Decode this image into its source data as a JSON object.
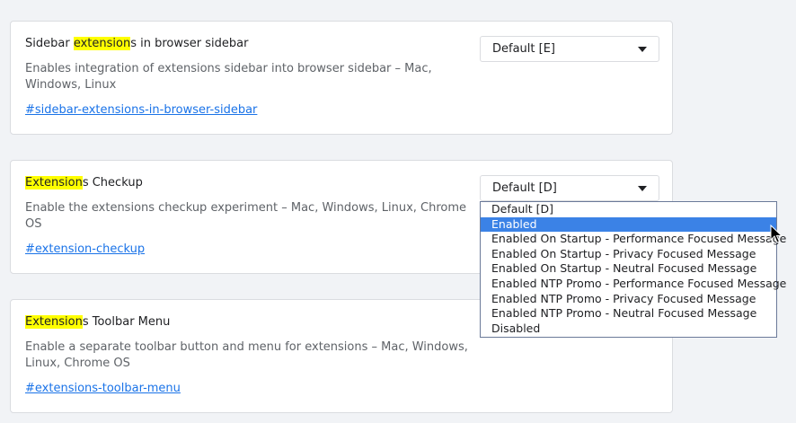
{
  "flags": [
    {
      "title_before": "Sidebar ",
      "title_highlight": "extension",
      "title_after": "s in browser sidebar",
      "description": "Enables integration of extensions sidebar into browser sidebar – Mac, Windows, Linux",
      "link": "#sidebar-extensions-in-browser-sidebar",
      "select_value": "Default [E]"
    },
    {
      "title_before": "",
      "title_highlight": "Extension",
      "title_after": "s Checkup",
      "description": "Enable the extensions checkup experiment – Mac, Windows, Linux, Chrome OS",
      "link": "#extension-checkup",
      "select_value": "Default [D]"
    },
    {
      "title_before": "",
      "title_highlight": "Extension",
      "title_after": "s Toolbar Menu",
      "description": "Enable a separate toolbar button and menu for extensions – Mac, Windows, Linux, Chrome OS",
      "link": "#extensions-toolbar-menu"
    }
  ],
  "dropdown": {
    "options": [
      "Default [D]",
      "Enabled",
      "Enabled On Startup - Performance Focused Message",
      "Enabled On Startup - Privacy Focused Message",
      "Enabled On Startup - Neutral Focused Message",
      "Enabled NTP Promo - Performance Focused Message",
      "Enabled NTP Promo - Privacy Focused Message",
      "Enabled NTP Promo - Neutral Focused Message",
      "Disabled"
    ],
    "highlighted_index": 1
  },
  "colors": {
    "highlight": "#ffff00",
    "link": "#1a73e8",
    "selected_option": "#3b82e6"
  }
}
